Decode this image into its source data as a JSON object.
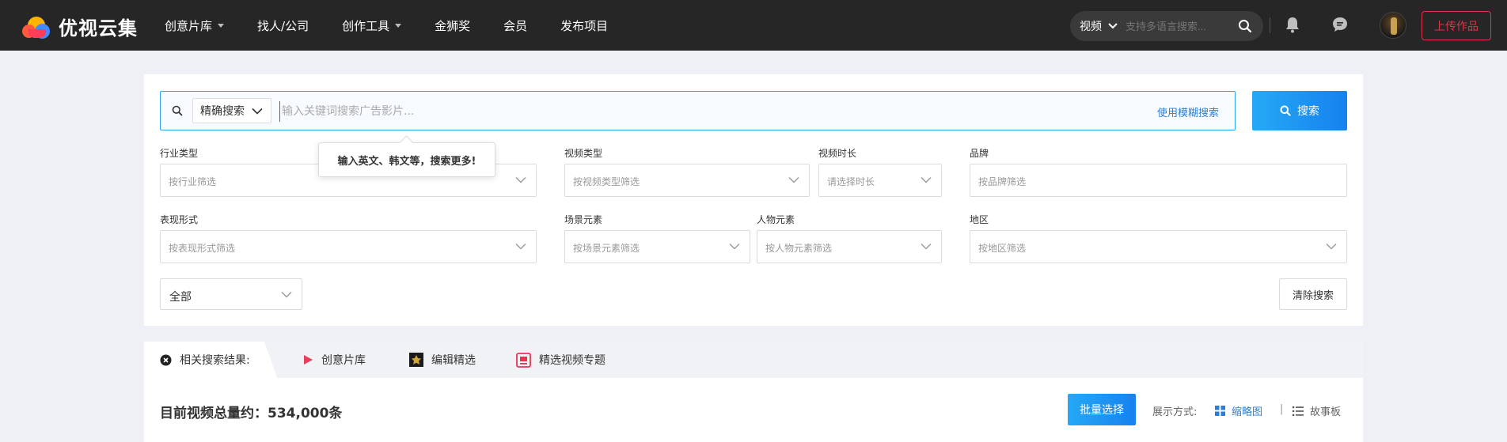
{
  "brand": {
    "name": "优视云集"
  },
  "nav": {
    "items": [
      {
        "label": "创意片库",
        "has_dropdown": true
      },
      {
        "label": "找人/公司",
        "has_dropdown": false
      },
      {
        "label": "创作工具",
        "has_dropdown": true
      },
      {
        "label": "金狮奖",
        "has_dropdown": false
      },
      {
        "label": "会员",
        "has_dropdown": false
      },
      {
        "label": "发布项目",
        "has_dropdown": false
      }
    ],
    "search": {
      "type": "视频",
      "placeholder": "支持多语言搜索..."
    },
    "upload_label": "上传作品",
    "accent": "#e0334a"
  },
  "search": {
    "mode": "精确搜索",
    "placeholder": "输入关键词搜索广告影片...",
    "fuzzy_link": "使用模糊搜索",
    "button": "搜索",
    "tooltip": "输入英文、韩文等，搜索更多!"
  },
  "filters": {
    "industry": {
      "label": "行业类型",
      "placeholder": "按行业筛选"
    },
    "video_type": {
      "label": "视频类型",
      "placeholder": "按视频类型筛选"
    },
    "duration": {
      "label": "视频时长",
      "placeholder": "请选择时长"
    },
    "brand": {
      "label": "品牌",
      "placeholder": "按品牌筛选"
    },
    "expression": {
      "label": "表现形式",
      "placeholder": "按表现形式筛选"
    },
    "scene": {
      "label": "场景元素",
      "placeholder": "按场景元素筛选"
    },
    "person": {
      "label": "人物元素",
      "placeholder": "按人物元素筛选"
    },
    "region": {
      "label": "地区",
      "placeholder": "按地区筛选"
    },
    "scope": "全部",
    "clear": "清除搜索"
  },
  "results": {
    "tabs": [
      {
        "label": "相关搜索结果:",
        "icon": "close-circle-icon"
      },
      {
        "label": "创意片库",
        "icon": "play-icon"
      },
      {
        "label": "编辑精选",
        "icon": "editor-pick-icon"
      },
      {
        "label": "精选视频专题",
        "icon": "featured-topic-icon"
      }
    ],
    "total": "目前视频总量约：534,000条",
    "batch": "批量选择",
    "display_label": "展示方式:",
    "views": [
      {
        "label": "缩略图",
        "active": true
      },
      {
        "label": "故事板",
        "active": false
      }
    ],
    "view_separator": "|"
  }
}
